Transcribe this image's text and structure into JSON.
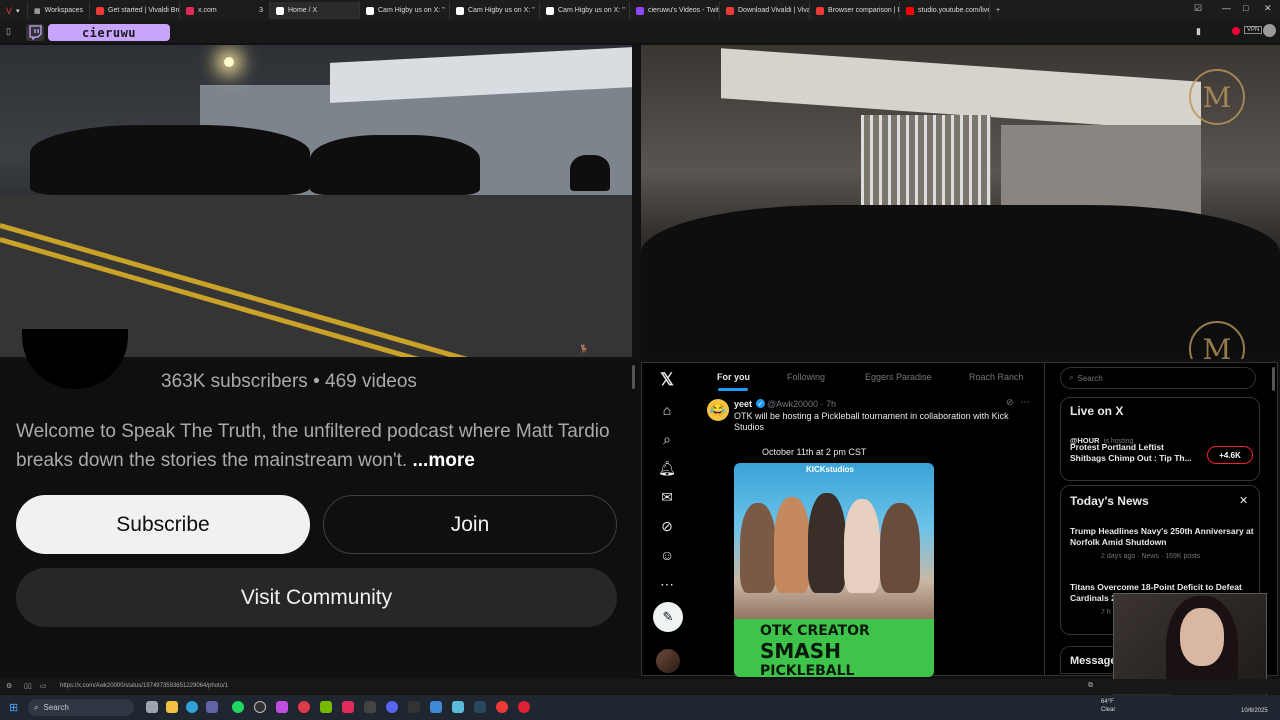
{
  "browser": {
    "workspaces_label": "Workspaces",
    "tabs": [
      {
        "label": "Get started | Vivaldi Browse",
        "color": "#ef3939"
      },
      {
        "label": "x.com",
        "color": "#e02b5a",
        "count": "3"
      },
      {
        "label": "Home / X",
        "color": "#ffffff"
      },
      {
        "label": "Cam Higby us on X: \"",
        "color": "#ffffff"
      },
      {
        "label": "Cam Higby us on X: \"",
        "color": "#ffffff"
      },
      {
        "label": "Cam Higby us on X: \"",
        "color": "#ffffff"
      },
      {
        "label": "cieruwu's Videos - Twitch",
        "color": "#9146ff"
      },
      {
        "label": "Download Vivaldi | Vivaldi",
        "color": "#ef3939"
      },
      {
        "label": "Browser comparison | Disc",
        "color": "#ef3939"
      },
      {
        "label": "studio.youtube.com/live_c",
        "color": "#ff0000"
      }
    ],
    "new_tab": "+",
    "channel_name": "cieruwu",
    "status_url": "https://x.com/Awk20000/status/1974973593651229064/photo/1"
  },
  "youtube": {
    "subscribers": "363K subscribers",
    "separator": "•",
    "videos": "469 videos",
    "description": "Welcome to Speak The Truth, the unfiltered podcast where Matt Tardio breaks down the stories the mainstream won't.",
    "more_label": "...more",
    "subscribe_label": "Subscribe",
    "join_label": "Join",
    "community_label": "Visit Community"
  },
  "x": {
    "tabs": [
      "For you",
      "Following",
      "Eggers Paradise",
      "Roach Ranch"
    ],
    "post": {
      "name": "yeet",
      "handle": "@Awk20000 · 7h",
      "text": "OTK will be hosting a Pickleball tournament in collaboration with Kick Studios",
      "date_line": "October 11th at 2 pm CST",
      "image_brand": "KICKstudios",
      "image_banner": [
        "OTK CREATOR",
        "SMASH",
        "PICKLEBALL"
      ]
    },
    "search_placeholder": "Search",
    "live": {
      "title": "Live on X",
      "host": "@HOUR",
      "host_suffix": "is hosting",
      "headline": "Protest Portland Leftist Shitbags Chimp Out : Tip Th...",
      "count": "+4.6K"
    },
    "news": {
      "title": "Today's News",
      "items": [
        {
          "headline": "Trump Headlines Navy's 250th Anniversary at Norfolk Amid Shutdown",
          "meta": "2 days ago · News · 169K posts"
        },
        {
          "headline": "Titans Overcome 18-Point Deficit to Defeat Cardinals 2",
          "meta": "7 h"
        }
      ]
    },
    "messages_label": "Messages"
  },
  "taskbar": {
    "search_label": "Search",
    "weather_temp": "64°F",
    "weather_desc": "Clear",
    "date": "10/6/2025"
  }
}
